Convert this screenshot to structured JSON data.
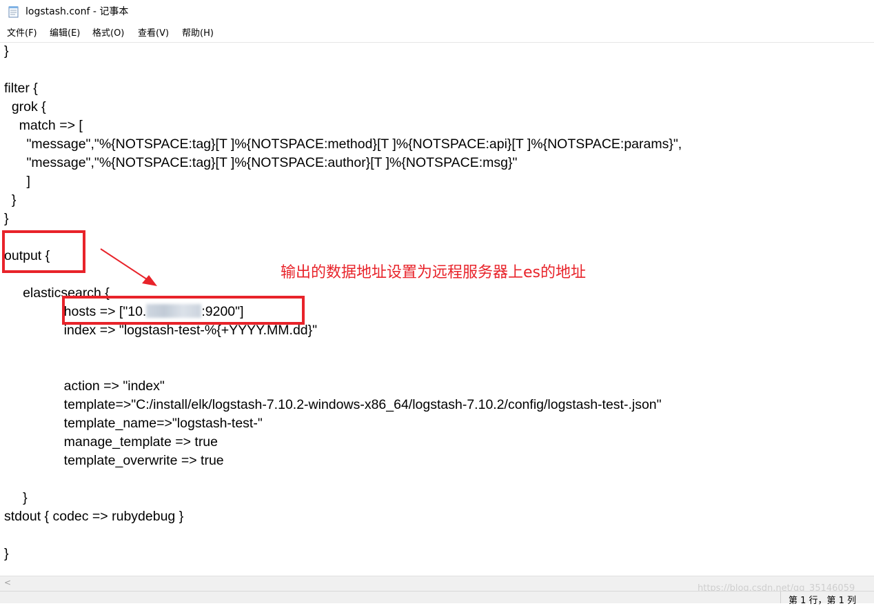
{
  "window": {
    "title": "logstash.conf - 记事本"
  },
  "menu": [
    "文件(F)",
    "编辑(E)",
    "格式(O)",
    "查看(V)",
    "帮助(H)"
  ],
  "code": {
    "l01": "}",
    "l02": "",
    "l03": "filter {",
    "l04": "  grok {",
    "l05": "    match => [",
    "l06": "      \"message\",\"%{NOTSPACE:tag}[T ]%{NOTSPACE:method}[T ]%{NOTSPACE:api}[T ]%{NOTSPACE:params}\",",
    "l07": "      \"message\",\"%{NOTSPACE:tag}[T ]%{NOTSPACE:author}[T ]%{NOTSPACE:msg}\"",
    "l08": "      ]",
    "l09": "  }",
    "l10": "}",
    "l11": "",
    "l12": "output {",
    "l13": "",
    "l14": "     elasticsearch {",
    "l15_pre": "                hosts => [\"10.",
    "l15_post": ":9200\"]",
    "l16": "                index => \"logstash-test-%{+YYYY.MM.dd}\"",
    "l17": "",
    "l18": "",
    "l19": "                action => \"index\"",
    "l20": "                template=>\"C:/install/elk/logstash-7.10.2-windows-x86_64/logstash-7.10.2/config/logstash-test-.json\"",
    "l21": "                template_name=>\"logstash-test-\"",
    "l22": "                manage_template => true",
    "l23": "                template_overwrite => true",
    "l24": "",
    "l25": "     }",
    "l26": "stdout { codec => rubydebug }",
    "l27": "",
    "l28": "}"
  },
  "annotation": {
    "text": "输出的数据地址设置为远程服务器上es的地址",
    "color": "#e8232a"
  },
  "status": {
    "position": "第 1 行，第 1 列"
  },
  "watermark": "https://blog.csdn.net/qq_35146059",
  "icons": {
    "app": "notepad-icon",
    "scroll_left": "scroll-left-arrow-icon"
  }
}
